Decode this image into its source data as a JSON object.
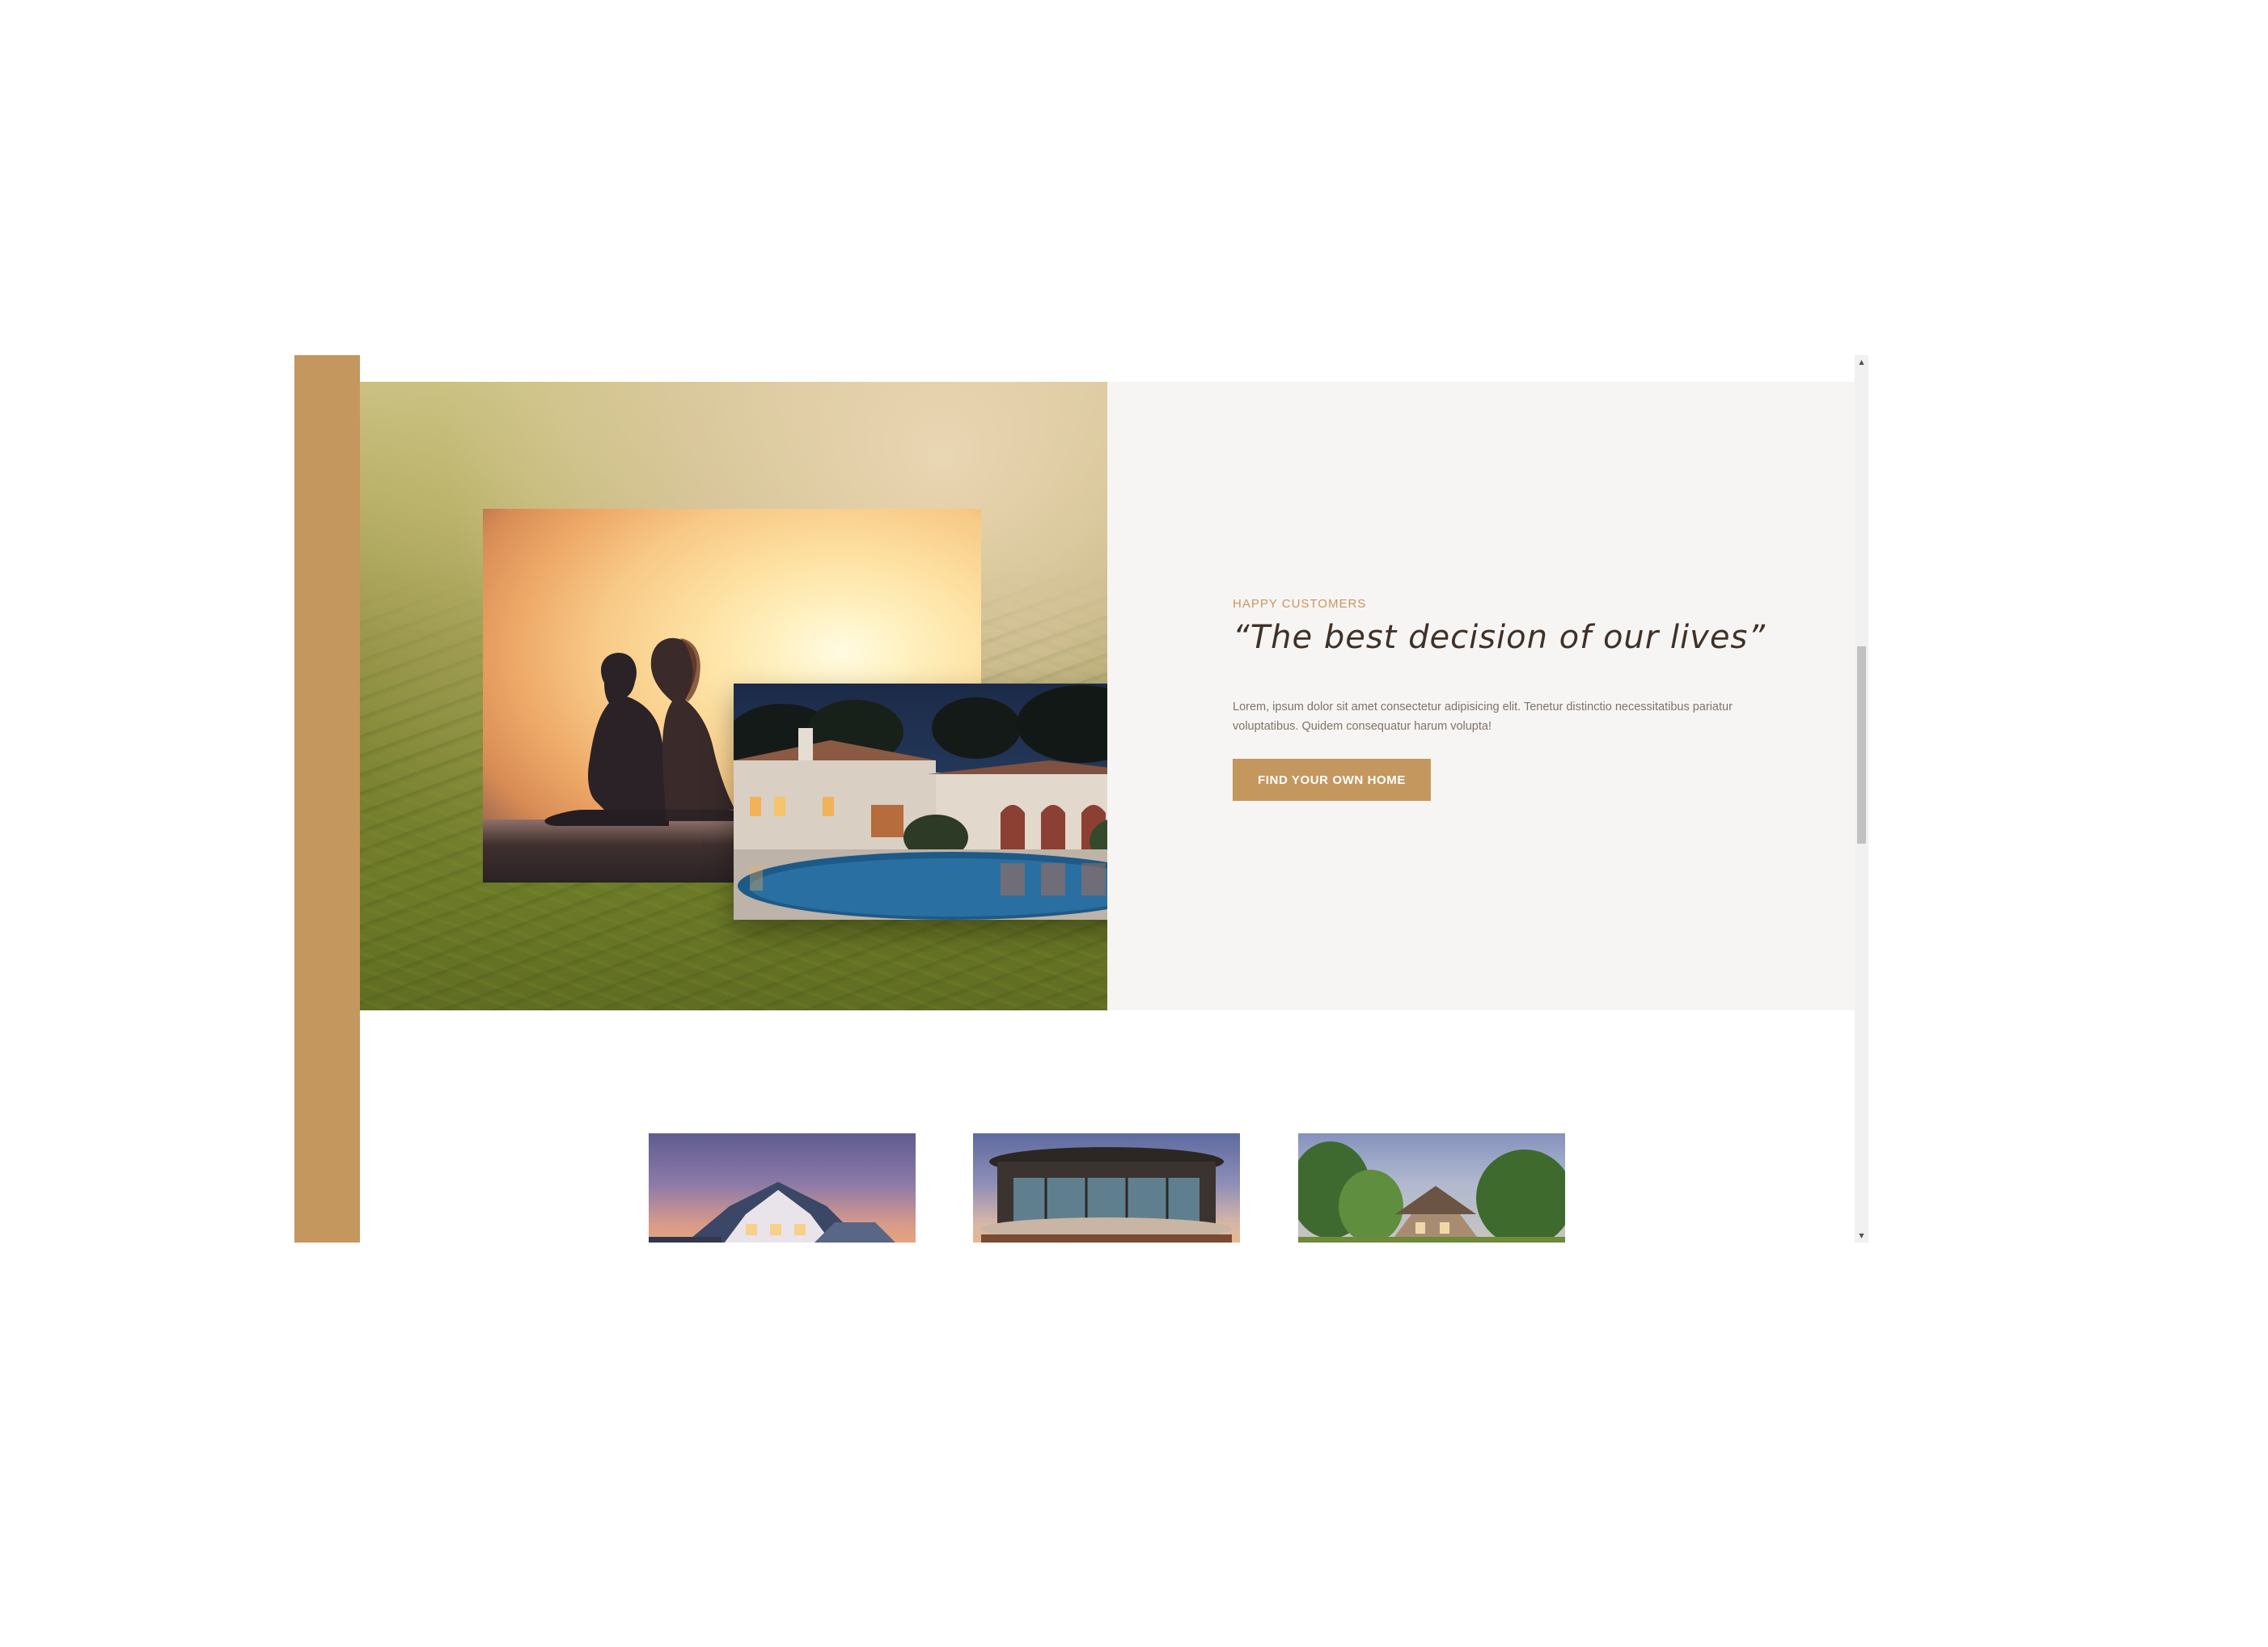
{
  "testimonial": {
    "eyebrow": "HAPPY CUSTOMERS",
    "quote": "“The best decision of our lives”",
    "body": "Lorem, ipsum dolor sit amet consectetur adipisicing elit. Tenetur distinctio necessitatibus pariatur voluptatibus. Quidem consequatur harum volupta!",
    "cta_label": "FIND YOUR OWN HOME",
    "photos": [
      "couple-sunset-photo",
      "villa-pool-photo"
    ]
  },
  "listings": {
    "cards": [
      {
        "image": "suburban-house-dusk-photo"
      },
      {
        "image": "round-modern-house-photo"
      },
      {
        "image": "country-house-trees-photo"
      }
    ]
  },
  "scrollbar": {
    "up_icon": "▲",
    "down_icon": "▼"
  },
  "colors": {
    "accent": "#c4975f",
    "text_dark": "#3f3128",
    "panel_bg": "#f7f5f3"
  }
}
